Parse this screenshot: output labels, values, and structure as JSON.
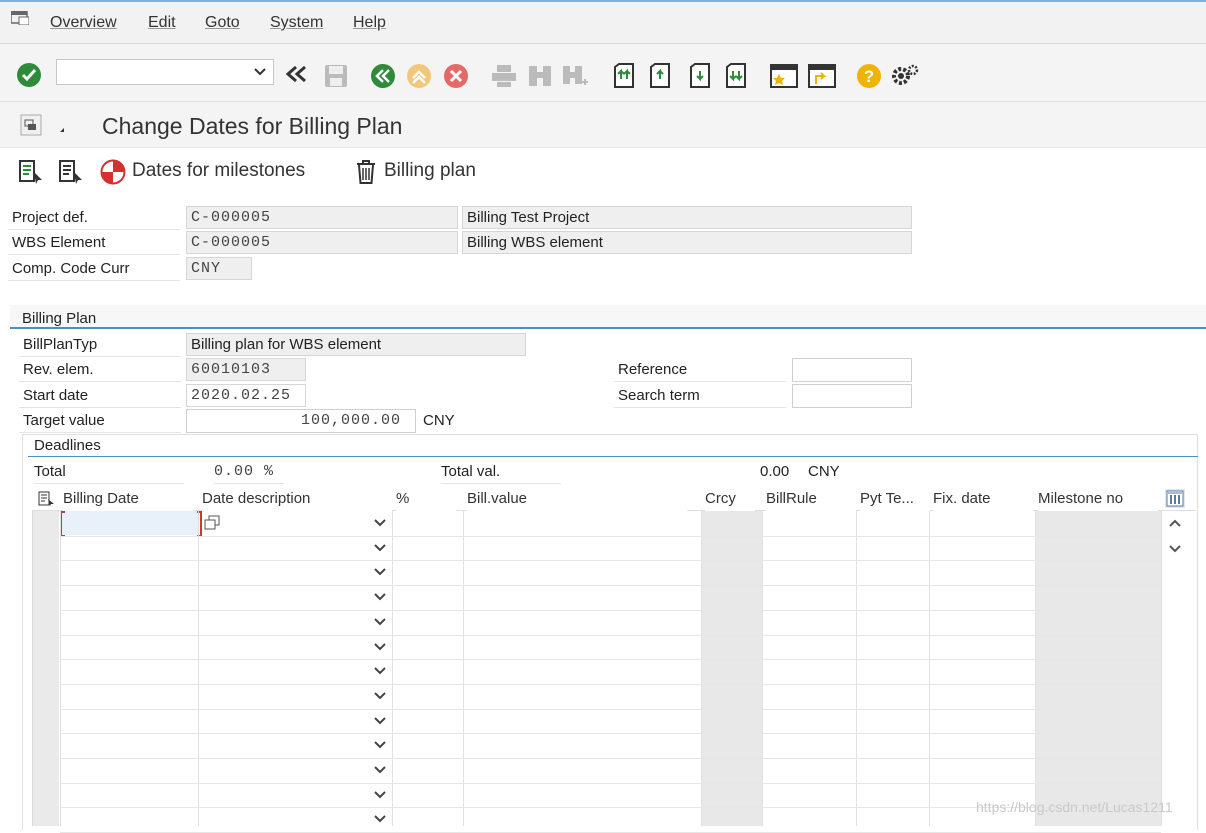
{
  "menu": {
    "items": [
      "Overview",
      "Edit",
      "Goto",
      "System",
      "Help"
    ]
  },
  "toolbar": {
    "command_value": "",
    "icons": [
      "enter-check-icon",
      "command-dropdown-icon",
      "collapse-icon",
      "save-icon",
      "back-icon",
      "exit-icon",
      "cancel-icon",
      "print-icon",
      "find-icon",
      "find-next-icon",
      "first-page-icon",
      "previous-page-icon",
      "next-page-icon",
      "last-page-icon",
      "create-session-icon",
      "generate-shortcut-icon",
      "help-icon",
      "settings-icon"
    ]
  },
  "title": {
    "text": "Change Dates for Billing Plan"
  },
  "app_toolbar": {
    "milestones_label": "Dates for milestones",
    "billing_plan_label": "Billing plan"
  },
  "header": {
    "project_def_label": "Project def.",
    "project_def_value": "C-000005",
    "project_def_desc": "Billing Test Project",
    "wbs_label": "WBS Element",
    "wbs_value": "C-000005",
    "wbs_desc": "Billing WBS element",
    "comp_curr_label": "Comp. Code Curr",
    "comp_curr_value": "CNY"
  },
  "billing_plan": {
    "group_title": "Billing Plan",
    "type_label": "BillPlanTyp",
    "type_value": "Billing plan for WBS element",
    "rev_label": "Rev. elem.",
    "rev_value": "60010103",
    "start_label": "Start date",
    "start_value": "2020.02.25",
    "target_label": "Target value",
    "target_value": "100,000.00",
    "target_curr": "CNY",
    "reference_label": "Reference",
    "search_label": "Search term"
  },
  "deadlines": {
    "group_title": "Deadlines",
    "total_label": "Total",
    "total_value": "0.00 %",
    "total_val_label": "Total val.",
    "total_val_value": "0.00",
    "total_val_curr": "CNY",
    "columns": [
      "Billing Date",
      "Date description",
      "%",
      "Bill.value",
      "Crcy",
      "BillRule",
      "Pyt Te...",
      "Fix. date",
      "Milestone no"
    ],
    "row_count": 13
  },
  "watermark": "https://blog.csdn.net/Lucas1211",
  "colors": {
    "accent": "#4a90c8",
    "ok_green": "#2e8b3a",
    "cancel_red": "#e04545",
    "help_gold": "#f0b400"
  }
}
